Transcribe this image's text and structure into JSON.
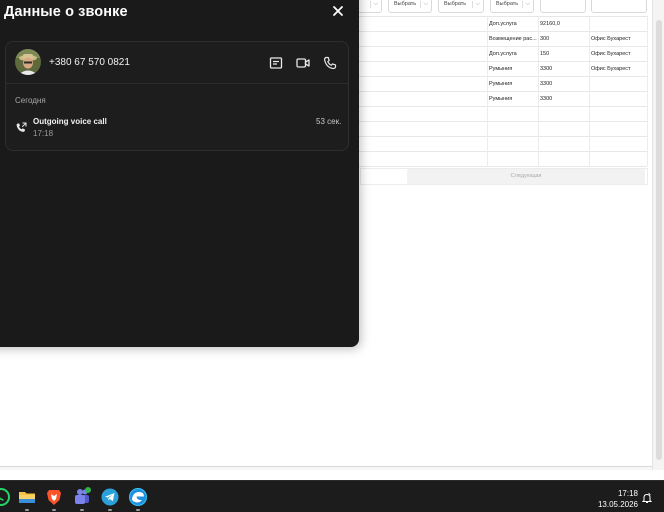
{
  "background_app": {
    "filters": [
      "Выбрать",
      "Выбрать",
      "Выбрать",
      "Выбрать"
    ],
    "rows": [
      {
        "type": "Доп.услуга",
        "amount": "92160,0",
        "office": ""
      },
      {
        "type": "Возмещение рас...",
        "amount": "300",
        "office": "Офис Бухарест"
      },
      {
        "type": "Доп.услуга",
        "amount": "150",
        "office": "Офис Бухарест"
      },
      {
        "type": "Румыния",
        "amount": "3300",
        "office": "Офис Бухарест"
      },
      {
        "type": "Румыния",
        "amount": "3300",
        "office": ""
      },
      {
        "type": "Румыния",
        "amount": "3300",
        "office": ""
      },
      {
        "type": "",
        "amount": "",
        "office": ""
      },
      {
        "type": "",
        "amount": "",
        "office": ""
      },
      {
        "type": "",
        "amount": "",
        "office": ""
      },
      {
        "type": "",
        "amount": "",
        "office": ""
      }
    ],
    "next_label": "Следующая"
  },
  "panel": {
    "title": "Данные о звонке",
    "contact": {
      "phone": "+380 67 570 0821"
    },
    "section": "Сегодня",
    "call": {
      "type": "Outgoing voice call",
      "time": "17:18",
      "duration": "53 сек."
    }
  },
  "taskbar": {
    "time": "17:18",
    "date": "13.05.2026",
    "apps": [
      "whatsapp-icon",
      "file-explorer-icon",
      "brave-browser-icon",
      "teams-icon",
      "telegram-icon",
      "edge-browser-icon"
    ]
  },
  "colors": {
    "panel_bg": "#1a1a1a",
    "taskbar_bg": "#1c1c1c",
    "telegram": "#2aa1da",
    "brave": "#fb542b",
    "whatsapp": "#25d366"
  }
}
